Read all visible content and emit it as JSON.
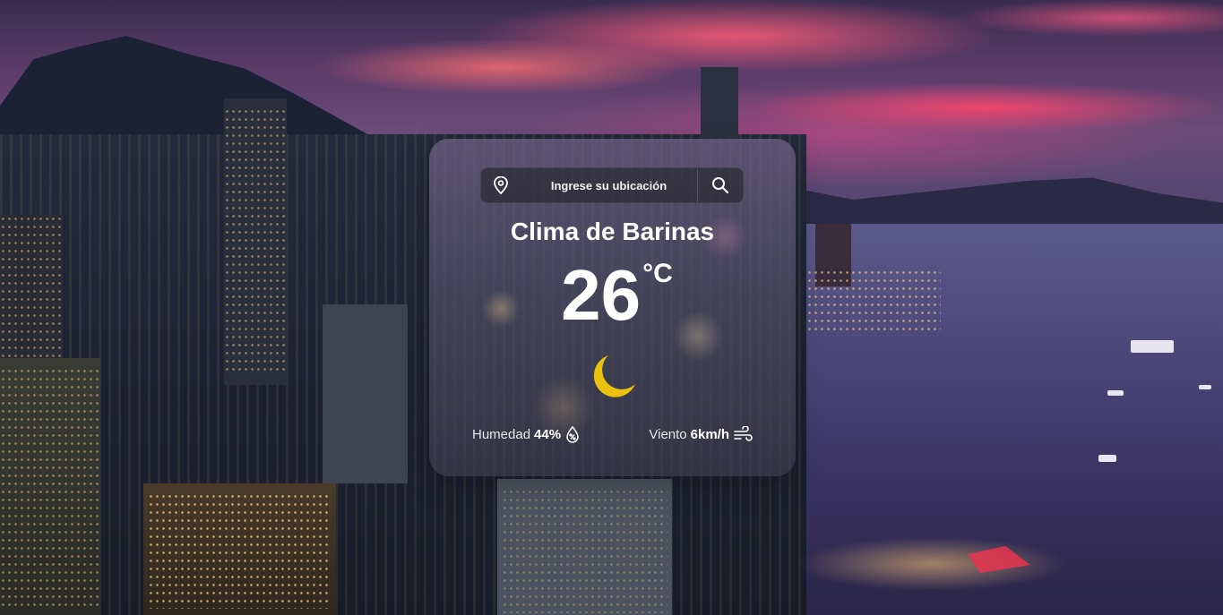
{
  "search": {
    "placeholder": "Ingrese su ubicación",
    "location_icon": "map-pin-icon",
    "search_icon": "search-icon"
  },
  "weather": {
    "title": "Clima de Barinas",
    "temperature": "26",
    "unit": "°C",
    "condition_icon": "crescent-moon-icon",
    "humidity_label": "Humedad",
    "humidity_value": "44%",
    "humidity_icon": "droplet-percent-icon",
    "wind_label": "Viento",
    "wind_value": "6km/h",
    "wind_icon": "wind-icon"
  },
  "colors": {
    "moon": "#e8c20c",
    "text": "#ffffff"
  }
}
